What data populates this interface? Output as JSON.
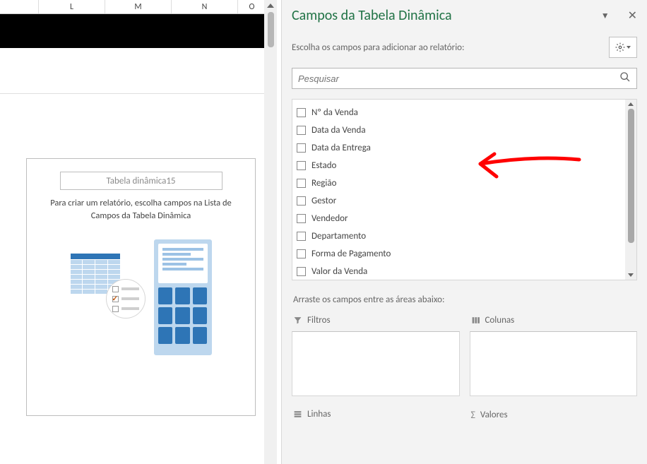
{
  "columns": [
    "L",
    "M",
    "N",
    "O"
  ],
  "pivot_placeholder": {
    "name": "Tabela dinâmica15",
    "instruction": "Para criar um relatório, escolha campos na Lista de Campos da Tabela Dinâmica"
  },
  "pane": {
    "title": "Campos da Tabela Dinâmica",
    "subtitle": "Escolha os campos para adicionar ao relatório:",
    "search_placeholder": "Pesquisar",
    "fields": [
      "Nº da Venda",
      "Data da Venda",
      "Data da Entrega",
      "Estado",
      "Região",
      "Gestor",
      "Vendedor",
      "Departamento",
      "Forma de Pagamento",
      "Valor da Venda"
    ],
    "areas_label": "Arraste os campos entre as áreas abaixo:",
    "areas": {
      "filters": "Filtros",
      "columns": "Colunas",
      "rows": "Linhas",
      "values": "Valores"
    }
  }
}
